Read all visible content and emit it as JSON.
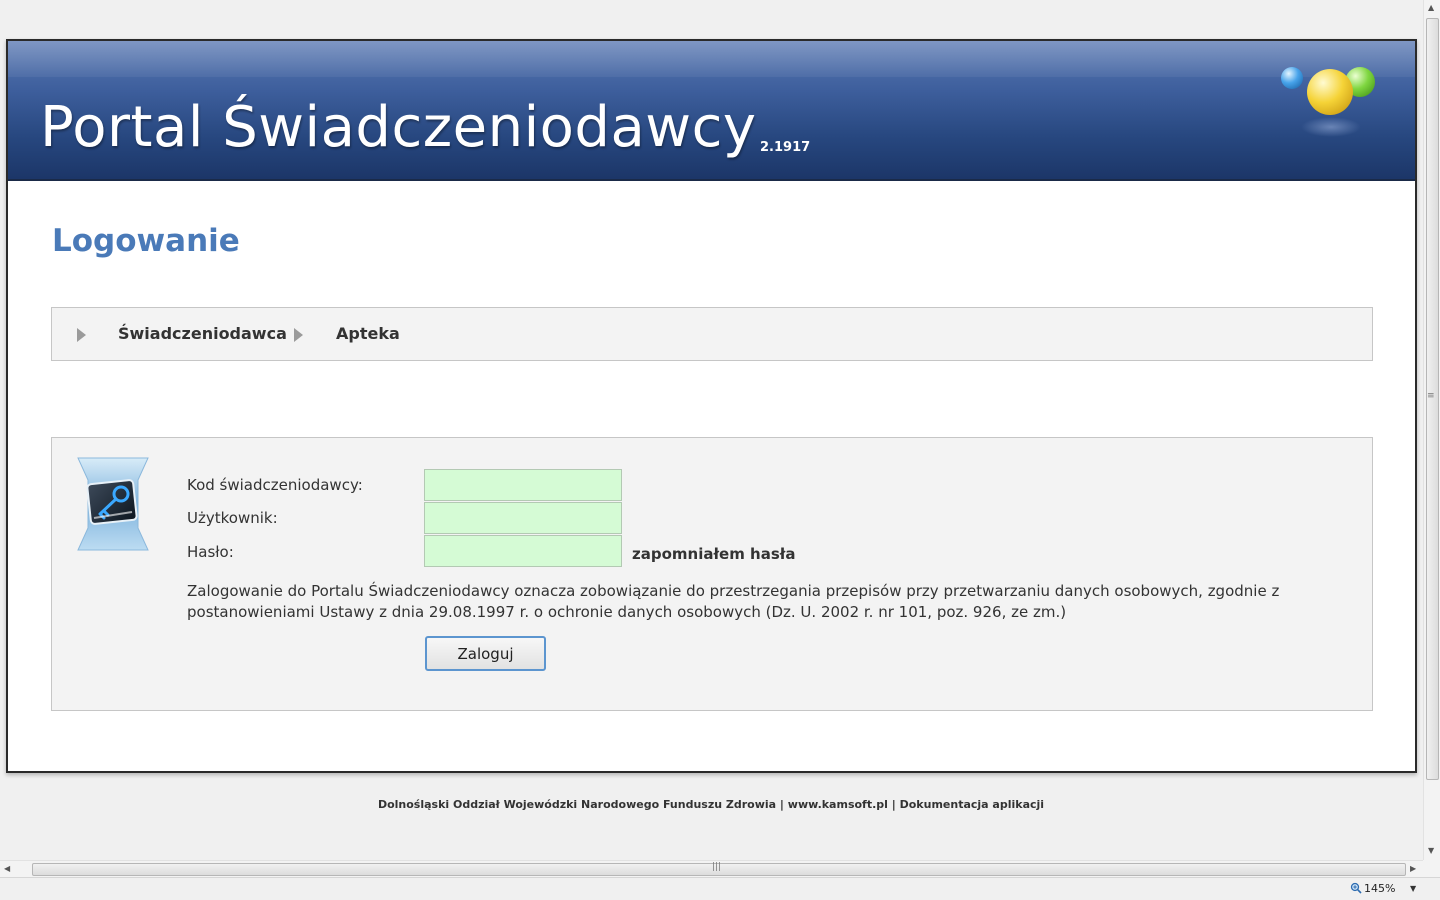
{
  "header": {
    "title": "Portal Świadczeniodawcy",
    "version": "2.1917"
  },
  "page": {
    "title": "Logowanie"
  },
  "tabs": [
    {
      "label": "Świadczeniodawca"
    },
    {
      "label": "Apteka"
    }
  ],
  "login": {
    "code_label": "Kod świadczeniodawcy:",
    "code_value": "",
    "user_label": "Użytkownik:",
    "user_value": "",
    "password_label": "Hasło:",
    "password_value": "",
    "forgot_label": "zapomniałem hasła",
    "notice": "Zalogowanie do Portalu Świadczeniodawcy oznacza zobowiązanie do przestrzegania przepisów przy przetwarzaniu danych osobowych, zgodnie z postanowieniami Ustawy z dnia 29.08.1997 r. o ochronie danych osobowych (Dz. U. 2002 r. nr 101, poz. 926, ze zm.)",
    "button_label": "Zaloguj"
  },
  "footer": {
    "org": "Dolnośląski Oddział Wojewódzki Narodowego Funduszu Zdrowia",
    "sep1": " | ",
    "site": "www.kamsoft.pl",
    "sep2": " | ",
    "docs": "Dokumentacja aplikacji"
  },
  "status": {
    "zoom": "145%"
  },
  "colors": {
    "header_blue": "#27477f",
    "title_blue": "#4a7ab8",
    "input_green": "#d5fbd5",
    "button_border": "#5c95cf"
  }
}
